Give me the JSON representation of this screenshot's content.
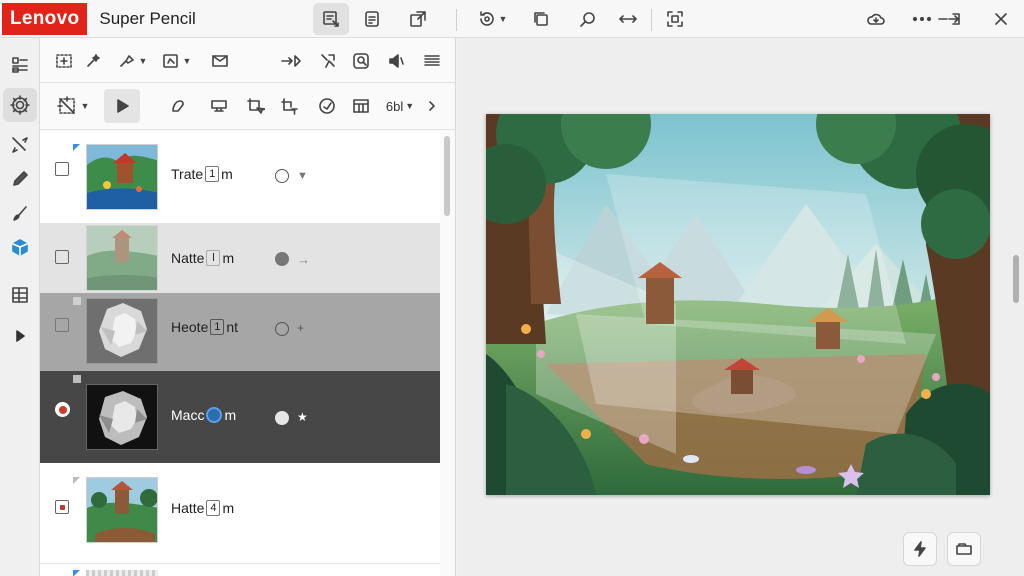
{
  "app": {
    "brand": "Lenovo",
    "title": "Super Pencil",
    "accent_color": "#e2231a"
  },
  "titlebar": {
    "buttons": [
      {
        "name": "canvas-view-icon",
        "active": true
      },
      {
        "name": "document-icon"
      },
      {
        "name": "share-export-icon"
      },
      {
        "name": "rotate-icon",
        "has_dropdown": true
      },
      {
        "name": "copy-layer-icon"
      },
      {
        "name": "zoom-icon"
      },
      {
        "name": "resize-horizontal-icon"
      },
      {
        "name": "fit-screen-icon"
      },
      {
        "name": "cloud-sync-icon"
      },
      {
        "name": "more-icon"
      },
      {
        "name": "close-icon"
      }
    ]
  },
  "rail": {
    "items": [
      "layers-icon",
      "settings-icon",
      "selection-icon",
      "pencil-icon",
      "brush-icon",
      "shape-3d-icon",
      "grid-icon",
      "expand-icon"
    ],
    "active": "settings-icon"
  },
  "toolbar_row1": [
    "transform-icon",
    "magic-icon",
    "select-dropdown-icon",
    "edit-dropdown-icon",
    "mail-icon",
    "move-forward-icon",
    "lasso-icon",
    "search-canvas-icon",
    "speaker-icon",
    "menu-lines-icon"
  ],
  "toolbar_row2": {
    "items": [
      "crop-dropdown-icon",
      "play-icon",
      "shape-icon",
      "stamp-icon",
      "crop-cursor-icon",
      "crop-text-icon",
      "color-picker-icon",
      "filter-icon",
      "font-size-icon",
      "chevron-right-icon"
    ],
    "font_size_label": "6bl",
    "active": "play-icon"
  },
  "layers": [
    {
      "name_pre": "Trate",
      "name_box": "1",
      "name_post": "m",
      "dot": "empty",
      "mark": "▼",
      "checkbox": "unchecked",
      "theme": "white"
    },
    {
      "name_pre": "Natte",
      "name_box": "l",
      "name_post": "m",
      "dot": "filled",
      "mark": "→",
      "checkbox": "unchecked",
      "theme": "lightgray"
    },
    {
      "name_pre": "Heote",
      "name_box": "1",
      "name_post": "nt",
      "dot": "empty",
      "mark": "+",
      "checkbox": "unchecked",
      "theme": "gray"
    },
    {
      "name_pre": "Macc",
      "name_box": "",
      "name_post": "m",
      "dot": "white",
      "mark": "★",
      "checkbox": "active",
      "theme": "dark"
    },
    {
      "name_pre": "Hatte",
      "name_box": "4",
      "name_post": "m",
      "dot": "none",
      "mark": "",
      "checkbox": "target",
      "theme": "white"
    }
  ],
  "canvas_footer": [
    "lightning-icon",
    "folder-icon"
  ]
}
